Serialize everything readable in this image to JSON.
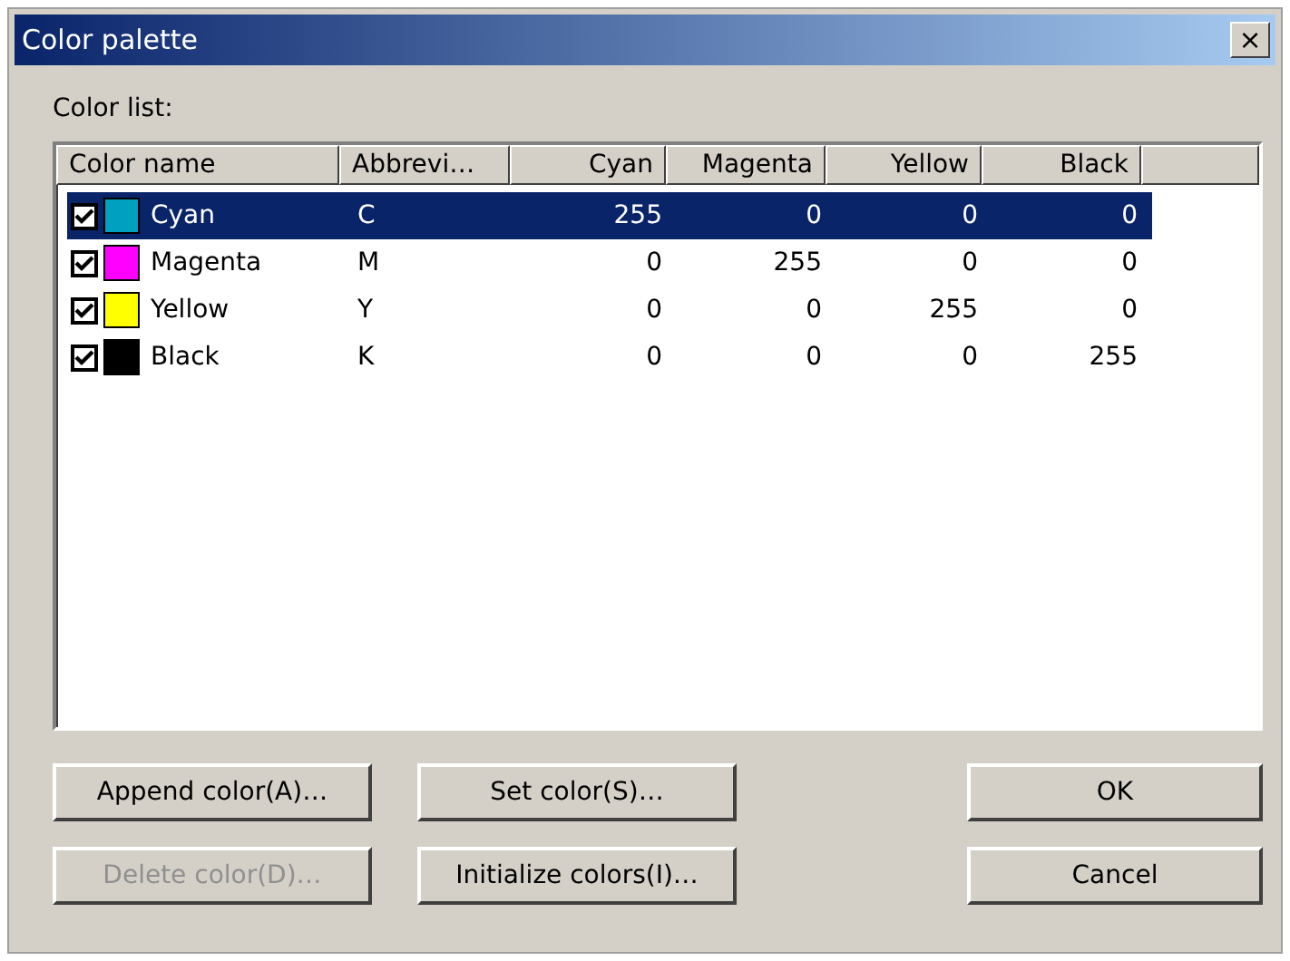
{
  "window": {
    "title": "Color palette",
    "close": "×"
  },
  "list_label": "Color list:",
  "table": {
    "columns": [
      "Color name",
      "Abbrevi…",
      "Cyan",
      "Magenta",
      "Yellow",
      "Black"
    ],
    "rows": [
      {
        "checked": true,
        "color": "#00a0c0",
        "selected": true,
        "cells": [
          "Cyan",
          "C",
          "255",
          "0",
          "0",
          "0"
        ]
      },
      {
        "checked": true,
        "color": "#ff00ff",
        "selected": false,
        "cells": [
          "Magenta",
          "M",
          "0",
          "255",
          "0",
          "0"
        ]
      },
      {
        "checked": true,
        "color": "#ffff00",
        "selected": false,
        "cells": [
          "Yellow",
          "Y",
          "0",
          "0",
          "255",
          "0"
        ]
      },
      {
        "checked": true,
        "color": "#000000",
        "selected": false,
        "cells": [
          "Black",
          "K",
          "0",
          "0",
          "0",
          "255"
        ]
      }
    ]
  },
  "buttons": [
    {
      "label": "Append color(A)…",
      "disabled": false
    },
    {
      "label": "Set color(S)…",
      "disabled": false
    },
    {
      "label": "OK",
      "disabled": false
    },
    {
      "label": "Delete color(D)…",
      "disabled": true
    },
    {
      "label": "Initialize colors(I)…",
      "disabled": false
    },
    {
      "label": "Cancel",
      "disabled": false
    }
  ]
}
